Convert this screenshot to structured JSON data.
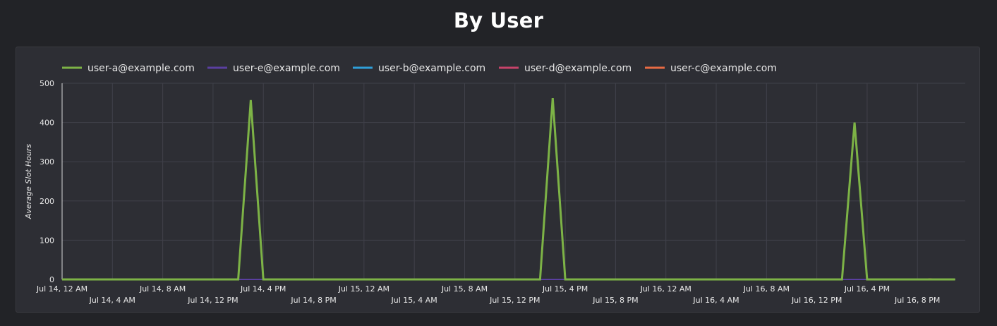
{
  "page": {
    "title": "By User"
  },
  "chart_data": {
    "type": "line",
    "title": "By User",
    "xlabel": "",
    "ylabel": "Average Slot Hours",
    "ylim": [
      0,
      500
    ],
    "yticks": [
      0,
      100,
      200,
      300,
      400,
      500
    ],
    "grid": true,
    "legend_position": "top-left",
    "x_start": "Jul 14, 12 AM",
    "x_end": "Jul 16, 11 PM",
    "x_ticks": [
      "Jul 14, 12 AM",
      "Jul 14, 4 AM",
      "Jul 14, 8 AM",
      "Jul 14, 12 PM",
      "Jul 14, 4 PM",
      "Jul 14, 8 PM",
      "Jul 15, 12 AM",
      "Jul 15, 4 AM",
      "Jul 15, 8 AM",
      "Jul 15, 12 PM",
      "Jul 15, 4 PM",
      "Jul 15, 8 PM",
      "Jul 16, 12 AM",
      "Jul 16, 4 AM",
      "Jul 16, 8 AM",
      "Jul 16, 12 PM",
      "Jul 16, 4 PM",
      "Jul 16, 8 PM"
    ],
    "series": [
      {
        "name": "user-a@example.com",
        "color": "#7db346",
        "points": [
          [
            "Jul 14, 12 AM",
            0
          ],
          [
            "Jul 14, 2 PM",
            0
          ],
          [
            "Jul 14, 3 PM",
            457
          ],
          [
            "Jul 14, 4 PM",
            0
          ],
          [
            "Jul 15, 2 PM",
            0
          ],
          [
            "Jul 15, 3 PM",
            462
          ],
          [
            "Jul 15, 4 PM",
            0
          ],
          [
            "Jul 16, 2 PM",
            0
          ],
          [
            "Jul 16, 3 PM",
            400
          ],
          [
            "Jul 16, 4 PM",
            0
          ],
          [
            "Jul 16, 11 PM",
            0
          ]
        ]
      },
      {
        "name": "user-e@example.com",
        "color": "#5a3fa0",
        "points": [
          [
            "Jul 14, 12 AM",
            0
          ],
          [
            "Jul 16, 11 PM",
            0
          ]
        ]
      },
      {
        "name": "user-b@example.com",
        "color": "#2f9fd8",
        "points": [
          [
            "Jul 14, 12 AM",
            0
          ],
          [
            "Jul 16, 11 PM",
            0
          ]
        ]
      },
      {
        "name": "user-d@example.com",
        "color": "#c7436a",
        "points": [
          [
            "Jul 14, 12 AM",
            0
          ],
          [
            "Jul 16, 11 PM",
            0
          ]
        ]
      },
      {
        "name": "user-c@example.com",
        "color": "#e86b43",
        "points": [
          [
            "Jul 14, 12 AM",
            0
          ],
          [
            "Jul 16, 8 PM",
            0
          ],
          [
            "Jul 16, 9 PM",
            1
          ],
          [
            "Jul 16, 10 PM",
            0
          ],
          [
            "Jul 16, 11 PM",
            0
          ]
        ]
      }
    ]
  }
}
